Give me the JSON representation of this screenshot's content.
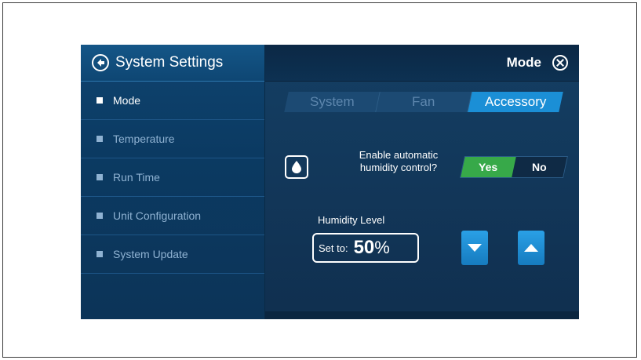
{
  "sidebar": {
    "title": "System Settings",
    "items": [
      {
        "label": "Mode",
        "active": true
      },
      {
        "label": "Temperature",
        "active": false
      },
      {
        "label": "Run Time",
        "active": false
      },
      {
        "label": "Unit Configuration",
        "active": false
      },
      {
        "label": "System Update",
        "active": false
      }
    ]
  },
  "header": {
    "title": "Mode"
  },
  "tabs": [
    {
      "label": "System",
      "active": false
    },
    {
      "label": "Fan",
      "active": false
    },
    {
      "label": "Accessory",
      "active": true
    }
  ],
  "humidity_control": {
    "question": "Enable automatic humidity control?",
    "yes_label": "Yes",
    "no_label": "No",
    "selected": "Yes"
  },
  "humidity_level": {
    "label": "Humidity Level",
    "set_prefix": "Set to:",
    "value": "50",
    "unit": "%"
  },
  "colors": {
    "accent": "#1b8fd6",
    "yes_selected": "#37a949",
    "panel": "#0f4470"
  }
}
